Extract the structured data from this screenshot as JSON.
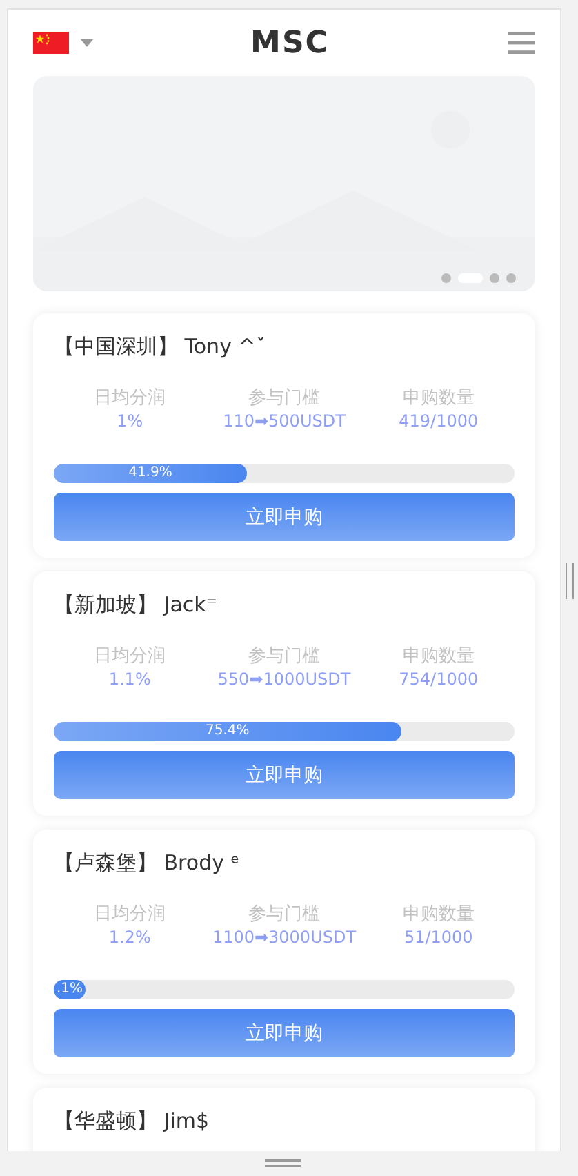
{
  "header": {
    "logo": "MSC"
  },
  "banner": {
    "dots": [
      {
        "selected": false
      },
      {
        "selected": true
      },
      {
        "selected": false
      },
      {
        "selected": false
      }
    ]
  },
  "products": [
    {
      "title": "【中国深圳】 Tony ^ˇ",
      "labels": [
        "日均分润",
        "参与门槛",
        "申购数量"
      ],
      "values": [
        "1%",
        "110➡500USDT",
        "419/1000"
      ],
      "level": 0.419,
      "progress_text": "41.9%",
      "button": "立即申购"
    },
    {
      "title": "【新加坡】 Jack⁼",
      "labels": [
        "日均分润",
        "参与门槛",
        "申购数量"
      ],
      "values": [
        "1.1%",
        "550➡1000USDT",
        "754/1000"
      ],
      "level": 0.754,
      "progress_text": "75.4%",
      "button": "立即申购"
    },
    {
      "title": "【卢森堡】 Brody ᵉ",
      "labels": [
        "日均分润",
        "参与门槛",
        "申购数量"
      ],
      "values": [
        "1.2%",
        "1100➡3000USDT",
        "51/1000"
      ],
      "level": 0.051,
      "progress_text": ".1%",
      "button": "立即申购"
    },
    {
      "title": "【华盛顿】 Jim$"
    }
  ]
}
